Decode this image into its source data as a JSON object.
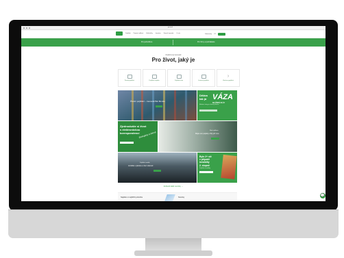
{
  "browser": {
    "title": "generali"
  },
  "header": {
    "nav": [
      "Pojištění",
      "Pojistné události",
      "Kalkulačky",
      "Investice",
      "Finanční poradci",
      "O nás"
    ],
    "right": [
      "Dokumenty",
      "CZ"
    ]
  },
  "band": {
    "left_tab": "Pro jednotlivce",
    "right_tab": "Pro firmy a podnikatele"
  },
  "hero": {
    "eyebrow": "Pojišťovna Generali",
    "title": "Pro život, jaký je"
  },
  "categories": [
    "Životní pojištění",
    "Pojištění majetku",
    "Pojištění auta",
    "Cestovní pojištění",
    "Všechna pojištění"
  ],
  "tiles": {
    "t1_title": "Životní pojištění – Generali Bel Mondo",
    "t2_a": "Dělám",
    "t2_b": "tak já",
    "t2_c": "VÁZA",
    "t2_d": "NA ČÍSTÉ PLÁT",
    "t2_body": "Moderní vázy pro krásný domov",
    "t3_a": "Zjednodušte si život",
    "t3_b": "s elektronickou",
    "t3_c": "korespondencí",
    "t3_script": "Ekologicky a šetrně",
    "t4_small": "Nová aplikace",
    "t4_main": "Mějte své pojistky vždy při ruce",
    "t5_small": "Pojištění vozidla",
    "t5_main": "Jezděte s jistotou a bez starostí",
    "t6_a": "Bylo 2+ síč",
    "t6_b": "v případě",
    "t6_c": "invalidity",
    "t6_d": "2. stupně",
    "t6_body": "Pojištění invalidity"
  },
  "more_link": "Zobrazit další novinky →",
  "bottom": {
    "left": "Najděte si nejbližší pobočku",
    "right": "Novinky"
  },
  "chat_icon": "💬"
}
